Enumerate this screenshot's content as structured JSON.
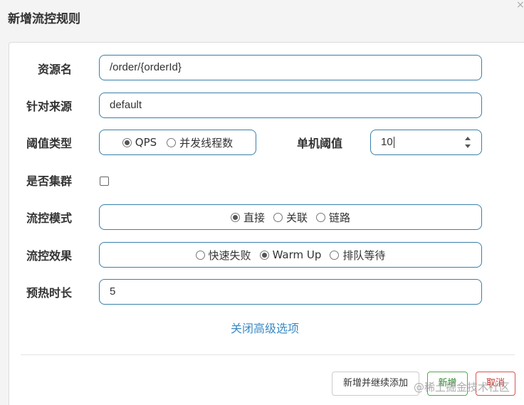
{
  "dialog": {
    "title": "新增流控规则",
    "close_glyph": "×"
  },
  "form": {
    "resource_name": {
      "label": "资源名",
      "value": "/order/{orderId}"
    },
    "limit_app": {
      "label": "针对来源",
      "value": "default"
    },
    "grade": {
      "label": "阈值类型",
      "options": [
        {
          "label": "QPS",
          "checked": true
        },
        {
          "label": "并发线程数",
          "checked": false
        }
      ]
    },
    "threshold": {
      "label": "单机阈值",
      "value": "10"
    },
    "cluster": {
      "label": "是否集群",
      "checked": false
    },
    "strategy": {
      "label": "流控模式",
      "options": [
        {
          "label": "直接",
          "checked": true
        },
        {
          "label": "关联",
          "checked": false
        },
        {
          "label": "链路",
          "checked": false
        }
      ]
    },
    "control_behavior": {
      "label": "流控效果",
      "options": [
        {
          "label": "快速失败",
          "checked": false
        },
        {
          "label": "Warm Up",
          "checked": true
        },
        {
          "label": "排队等待",
          "checked": false
        }
      ]
    },
    "warmup_period": {
      "label": "预热时长",
      "value": "5"
    },
    "advanced_toggle": "关闭高级选项"
  },
  "footer": {
    "continue_label": "新增并继续添加",
    "add_label": "新增",
    "cancel_label": "取消"
  },
  "watermark": "@稀土掘金技术社区",
  "colors": {
    "field_border": "#3a7fa8",
    "link": "#3a8ac4",
    "add_button": "#4cae4c",
    "cancel_button": "#d9534f"
  }
}
